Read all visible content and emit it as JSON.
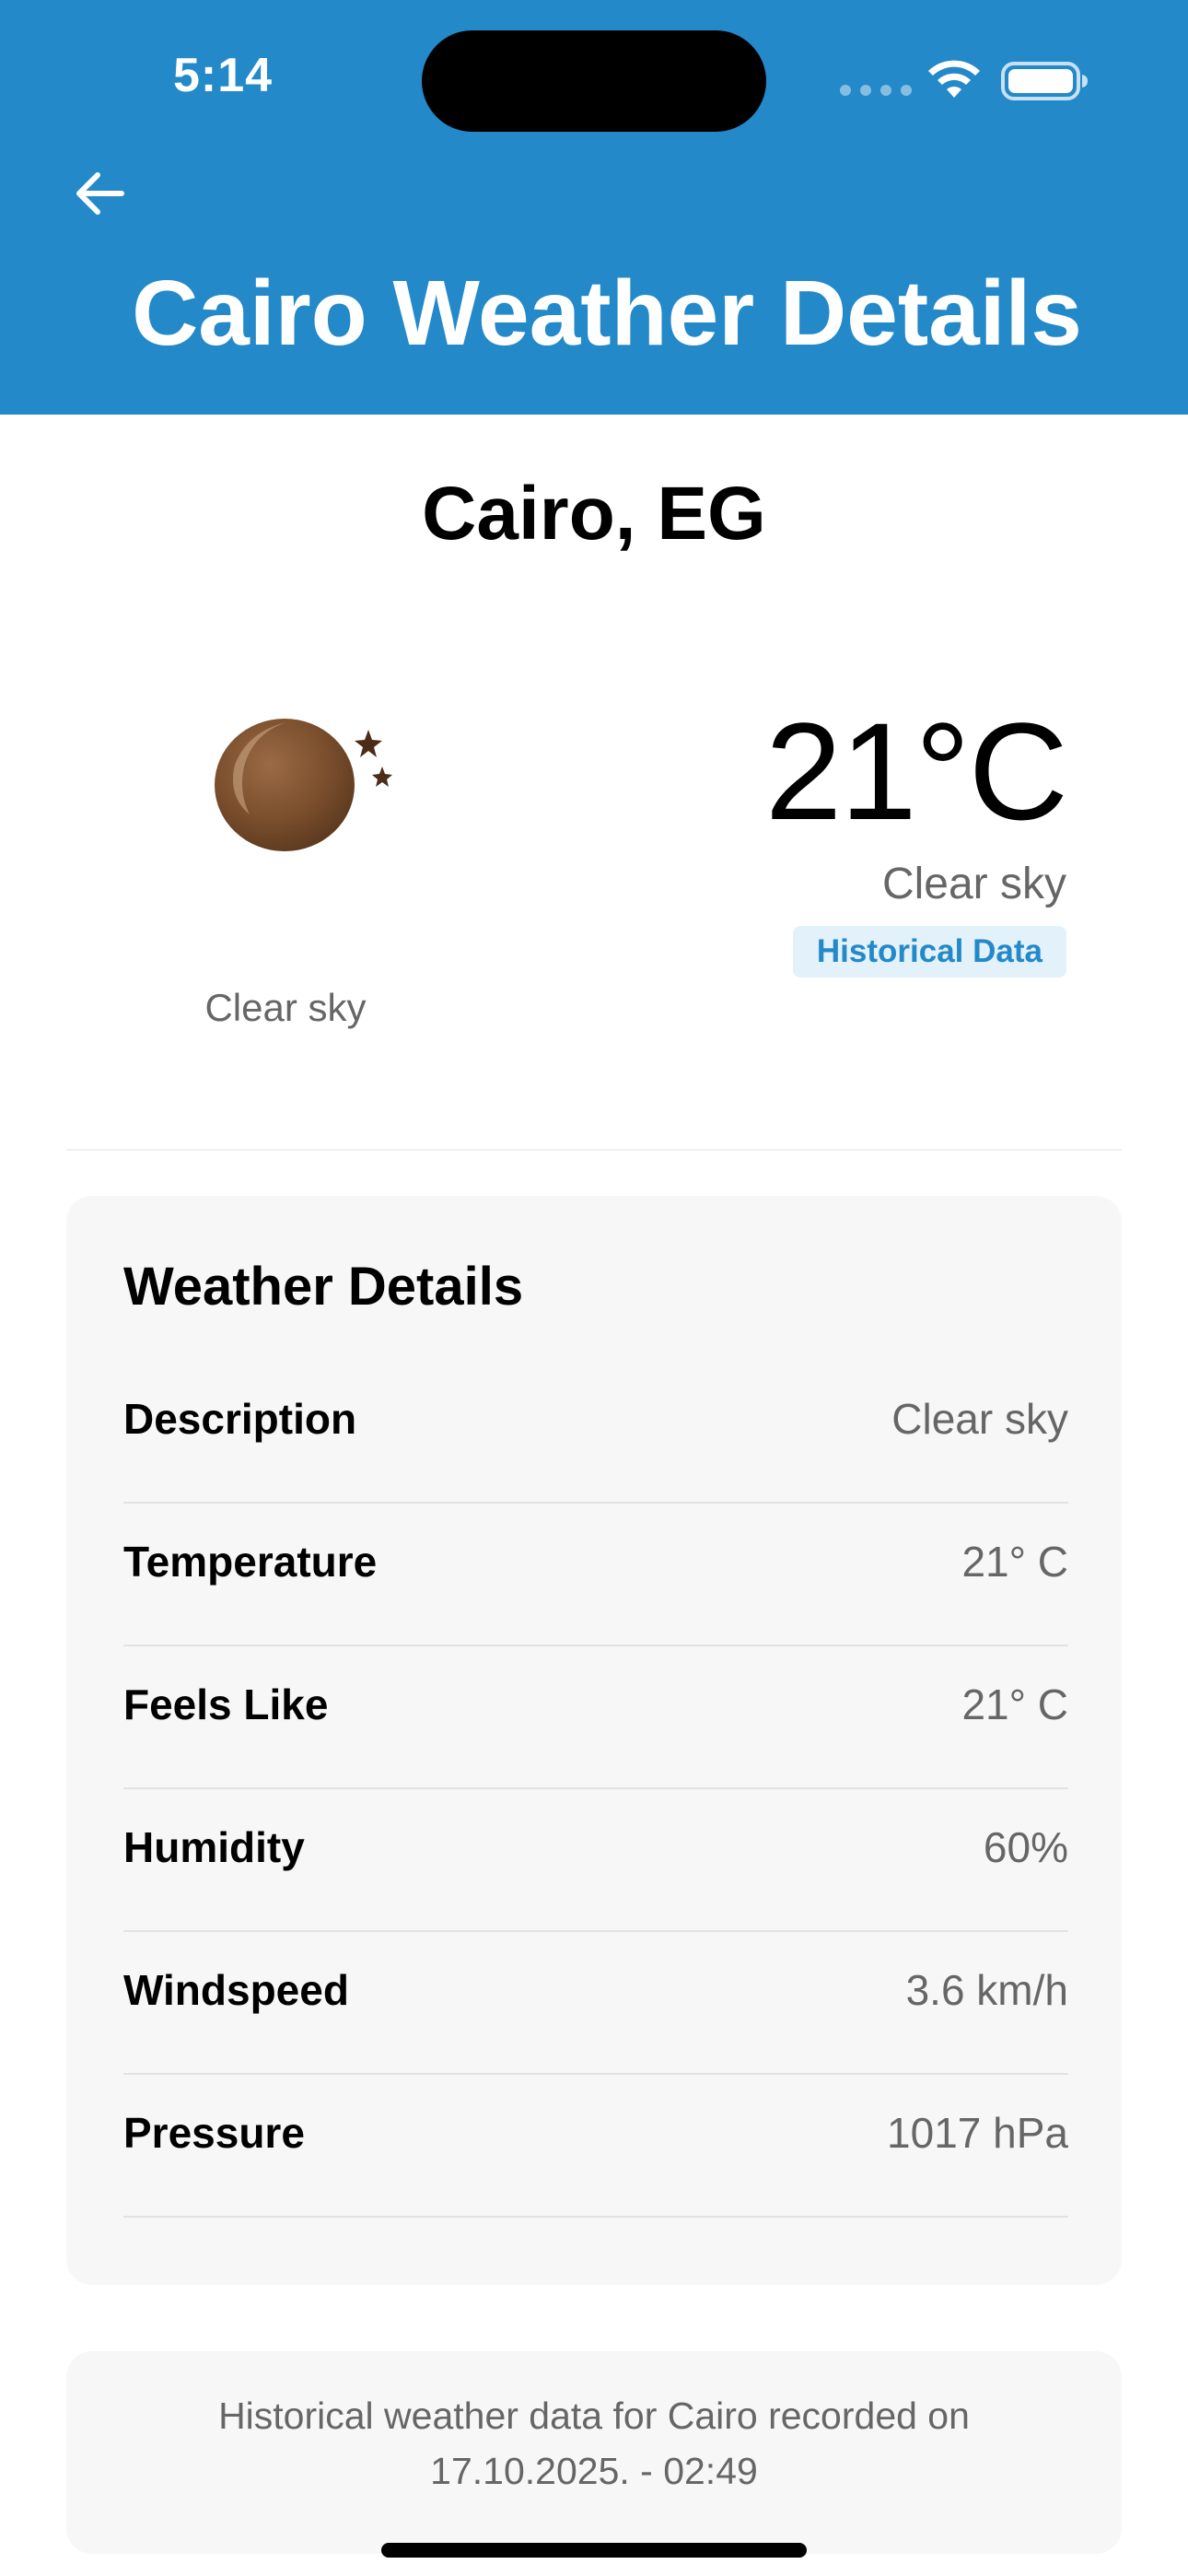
{
  "status_bar": {
    "time": "5:14"
  },
  "header": {
    "title": "Cairo Weather Details",
    "back_icon": "arrow-left-icon",
    "background_color": "#2389c9"
  },
  "location": {
    "city": "Cairo, EG"
  },
  "current": {
    "icon": "moon-stars-icon",
    "icon_caption": "Clear sky",
    "temperature": "21°C",
    "description": "Clear sky",
    "badge": "Historical Data"
  },
  "details": {
    "title": "Weather Details",
    "rows": [
      {
        "label": "Description",
        "value": "Clear sky"
      },
      {
        "label": "Temperature",
        "value": "21° C"
      },
      {
        "label": "Feels Like",
        "value": "21° C"
      },
      {
        "label": "Humidity",
        "value": "60%"
      },
      {
        "label": "Windspeed",
        "value": "3.6 km/h"
      },
      {
        "label": "Pressure",
        "value": "1017 hPa"
      }
    ]
  },
  "footer": {
    "line1": "Historical weather data for Cairo recorded on",
    "line2": "17.10.2025. - 02:49"
  }
}
